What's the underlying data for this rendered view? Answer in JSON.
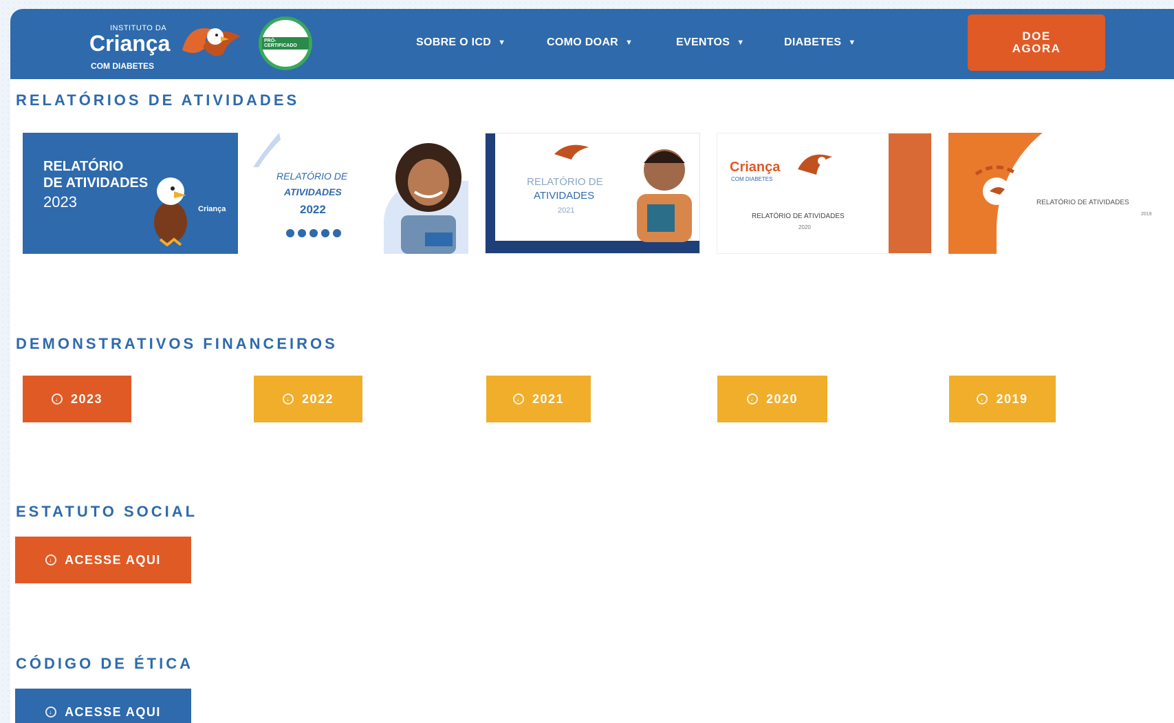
{
  "colors": {
    "navbar": "#2e6aac",
    "accent_orange": "#e05a26",
    "accent_yellow": "#f0ae2a",
    "heading_blue": "#2e6aac"
  },
  "header": {
    "logo": {
      "line1": "INSTITUTO DA",
      "line2": "Criança",
      "line3": "COM DIABETES"
    },
    "seal_text": "PRÓ-CERTIFICADO",
    "nav": [
      {
        "label": "SOBRE O ICD",
        "icon": "caret-down-icon"
      },
      {
        "label": "COMO DOAR",
        "icon": "caret-down-icon"
      },
      {
        "label": "EVENTOS",
        "icon": "caret-down-icon"
      },
      {
        "label": "DIABETES",
        "icon": "caret-down-icon"
      }
    ],
    "donate_label": "DOE\nAGORA"
  },
  "relatorios": {
    "title": "RELATÓRIOS DE ATIVIDADES",
    "covers": [
      {
        "line1": "RELATÓRIO",
        "line2": "DE ATIVIDADES",
        "year": "2023",
        "brand": "Criança"
      },
      {
        "line1": "RELATÓRIO DE",
        "line2": "ATIVIDADES",
        "year": "2022"
      },
      {
        "line1": "RELATÓRIO DE",
        "line2": "ATIVIDADES",
        "year": "2021"
      },
      {
        "brand": "Criança",
        "sub": "COM DIABETES",
        "line1": "RELATÓRIO DE ATIVIDADES",
        "year": "2020"
      },
      {
        "line1": "RELATÓRIO DE ATIVIDADES",
        "year": "2019"
      }
    ]
  },
  "demonstrativos": {
    "title": "DEMONSTRATIVOS FINANCEIROS",
    "buttons": [
      {
        "label": "2023",
        "icon": "download-circle-icon"
      },
      {
        "label": "2022",
        "icon": "download-circle-icon"
      },
      {
        "label": "2021",
        "icon": "download-circle-icon"
      },
      {
        "label": "2020",
        "icon": "download-circle-icon"
      },
      {
        "label": "2019",
        "icon": "download-circle-icon"
      }
    ]
  },
  "estatuto": {
    "title": "ESTATUTO SOCIAL",
    "button_label": "ACESSE AQUI"
  },
  "codigo": {
    "title": "CÓDIGO DE ÉTICA",
    "button_label": "ACESSE AQUI"
  }
}
